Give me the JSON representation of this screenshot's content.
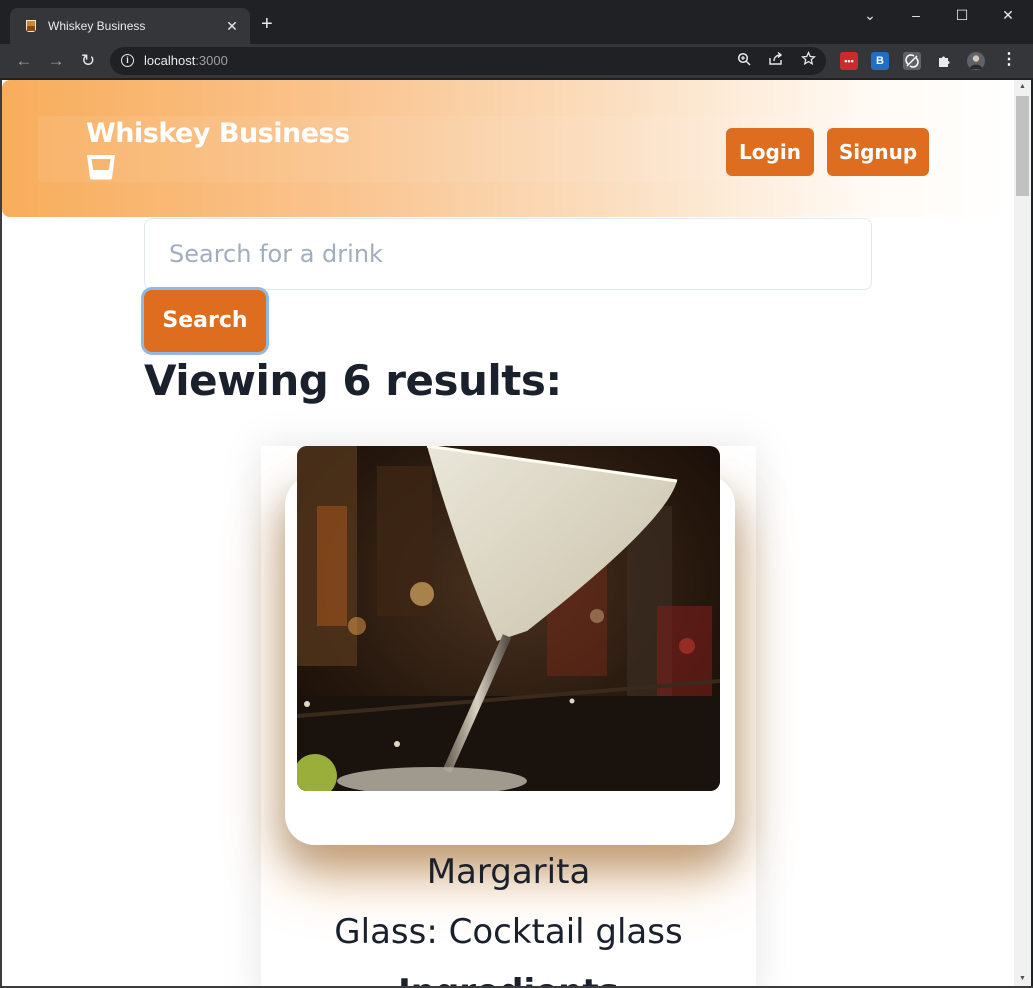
{
  "browser": {
    "tab_title": "Whiskey Business",
    "tab_close": "✕",
    "new_tab": "+",
    "url_host": "localhost",
    "url_port": ":3000",
    "window_controls": {
      "dropdown": "⌄",
      "minimize": "–",
      "maximize": "☐",
      "close": "✕"
    },
    "nav": {
      "back": "←",
      "forward": "→",
      "reload": "↻"
    },
    "icons": [
      "zoom-icon",
      "share-icon",
      "star-icon",
      "extension-lastpass-icon",
      "extension-b-icon",
      "extension-sync-icon",
      "puzzle-icon",
      "profile-icon",
      "menu-icon"
    ]
  },
  "header": {
    "brand": "Whiskey Business",
    "login_label": "Login",
    "signup_label": "Signup",
    "accent": "#df6d1f"
  },
  "search": {
    "placeholder": "Search for a drink",
    "value": "",
    "button_label": "Search"
  },
  "results": {
    "heading": "Viewing 6 results:",
    "cards": [
      {
        "title": "Margarita",
        "glass": "Glass: Cocktail glass",
        "next_line": "Ingredients"
      }
    ]
  }
}
